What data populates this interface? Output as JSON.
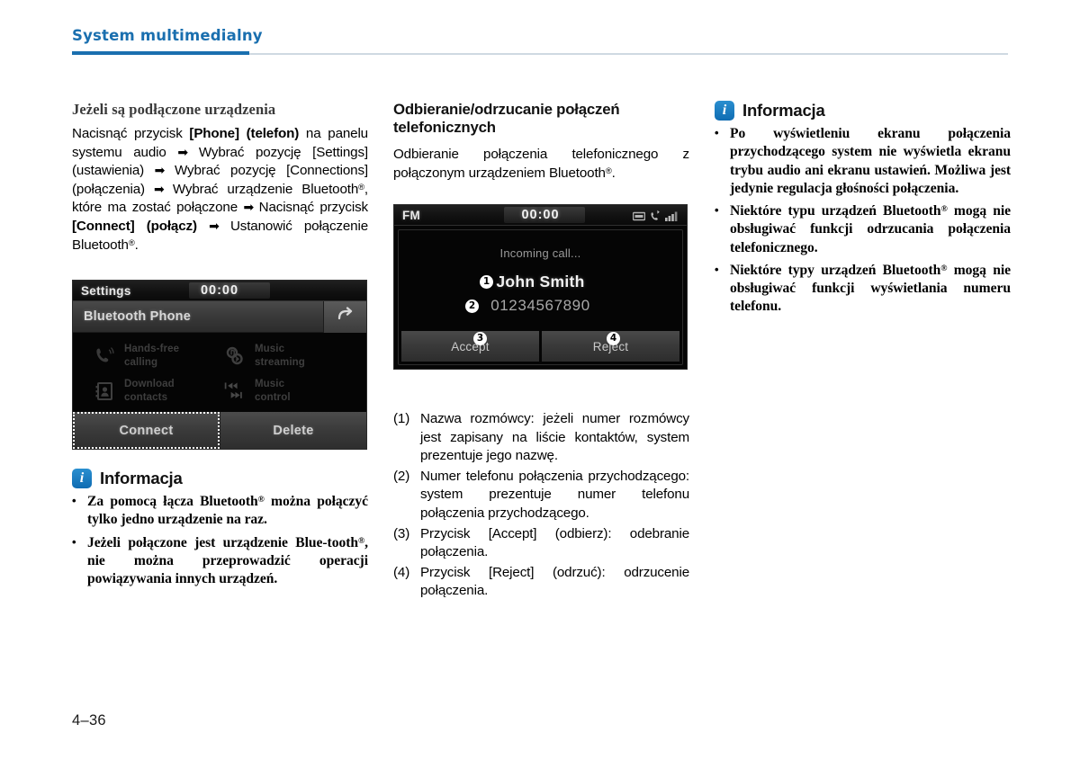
{
  "header": {
    "title": "System multimedialny",
    "accent_color": "#1a6faf"
  },
  "footer": {
    "page_number": "4–36"
  },
  "column_1": {
    "subheading": "Jeżeli są podłączone urządzenia",
    "paragraph_parts": {
      "p1": "Nacisnąć przycisk ",
      "b1": "[Phone] (telefon)",
      "p2": " na panelu systemu audio ",
      "a1": "➡",
      "p3": " Wybrać pozycję [Settings] (ustawienia) ",
      "a2": "➡",
      "p4": " Wybrać pozycję [Connections] (połączenia) ",
      "a3": "➡",
      "p5": " Wybrać urządzenie Bluetooth",
      "reg1": "®",
      "p6": ", które ma zostać połączone ",
      "a4": "➡",
      "p7": " Nacisnąć przycisk ",
      "b2": "[Connect] (połącz)",
      "a5": "➡",
      "p8": " Ustanowić połączenie Bluetooth",
      "reg2": "®",
      "p9": "."
    },
    "settings_screen": {
      "source_label": "Settings",
      "clock": "00:00",
      "sub_title": "Bluetooth Phone",
      "back_icon": "back-arrow-icon",
      "features": [
        {
          "icon": "handsfree-phone-icon",
          "label": "Hands-free\ncalling"
        },
        {
          "icon": "music-streaming-icon",
          "label": "Music\nstreaming"
        },
        {
          "icon": "download-contacts-icon",
          "label": "Download\ncontacts"
        },
        {
          "icon": "music-control-icon",
          "label": "Music\ncontrol"
        }
      ],
      "buttons": [
        {
          "label": "Connect",
          "selected": true
        },
        {
          "label": "Delete",
          "selected": false
        }
      ]
    },
    "info": {
      "icon": "info-icon",
      "title": "Informacja",
      "items": [
        {
          "bullet": "•",
          "pre": "Za pomocą łącza Bluetooth",
          "reg": "®",
          "post": " można połączyć tylko jedno urządzenie na raz."
        },
        {
          "bullet": "•",
          "pre": "Jeżeli połączone jest urządzenie Blue-tooth",
          "reg": "®",
          "post": ", nie można przeprowadzić operacji powiązywania innych urządzeń."
        }
      ]
    }
  },
  "column_2": {
    "heading": "Odbieranie/odrzucanie połączeń telefonicznych",
    "intro": {
      "pre": "Odbieranie połączenia telefonicznego z połączonym urządzeniem Bluetooth",
      "reg": "®",
      "post": "."
    },
    "call_screen": {
      "source_label": "FM",
      "clock": "00:00",
      "status_icons": [
        "media-card-icon",
        "bluetooth-phone-icon",
        "signal-strength-icon"
      ],
      "status_text": "Incoming call...",
      "caller_name": "John Smith",
      "caller_number": "01234567890",
      "buttons": [
        {
          "label": "Accept"
        },
        {
          "label": "Reject"
        }
      ],
      "callouts": [
        "1",
        "2",
        "3",
        "4"
      ]
    },
    "numbered_list": [
      {
        "num": "(1)",
        "text": "Nazwa rozmówcy: jeżeli numer rozmówcy jest zapisany na liście kontaktów, system prezentuje jego nazwę."
      },
      {
        "num": "(2)",
        "text": "Numer telefonu połączenia przychodzącego: system prezentuje numer telefonu połączenia przychodzącego."
      },
      {
        "num": "(3)",
        "text": "Przycisk [Accept] (odbierz): odebranie połączenia."
      },
      {
        "num": "(4)",
        "text": "Przycisk [Reject] (odrzuć): odrzucenie połączenia."
      }
    ]
  },
  "column_3": {
    "info": {
      "icon": "info-icon",
      "title": "Informacja",
      "items": [
        {
          "bullet": "•",
          "pre": "Po wyświetleniu ekranu połączenia przychodzącego system nie wyświetla ekranu trybu audio ani ekranu ustawień. Możliwa jest jedynie regulacja głośności połączenia.",
          "reg": "",
          "post": ""
        },
        {
          "bullet": "•",
          "pre": "Niektóre typu urządzeń Bluetooth",
          "reg": "®",
          "post": " mogą nie obsługiwać funkcji odrzucania połączenia telefonicznego."
        },
        {
          "bullet": "•",
          "pre": "Niektóre typy urządzeń Bluetooth",
          "reg": "®",
          "post": " mogą nie obsługiwać funkcji wyświetlania numeru telefonu."
        }
      ]
    }
  }
}
